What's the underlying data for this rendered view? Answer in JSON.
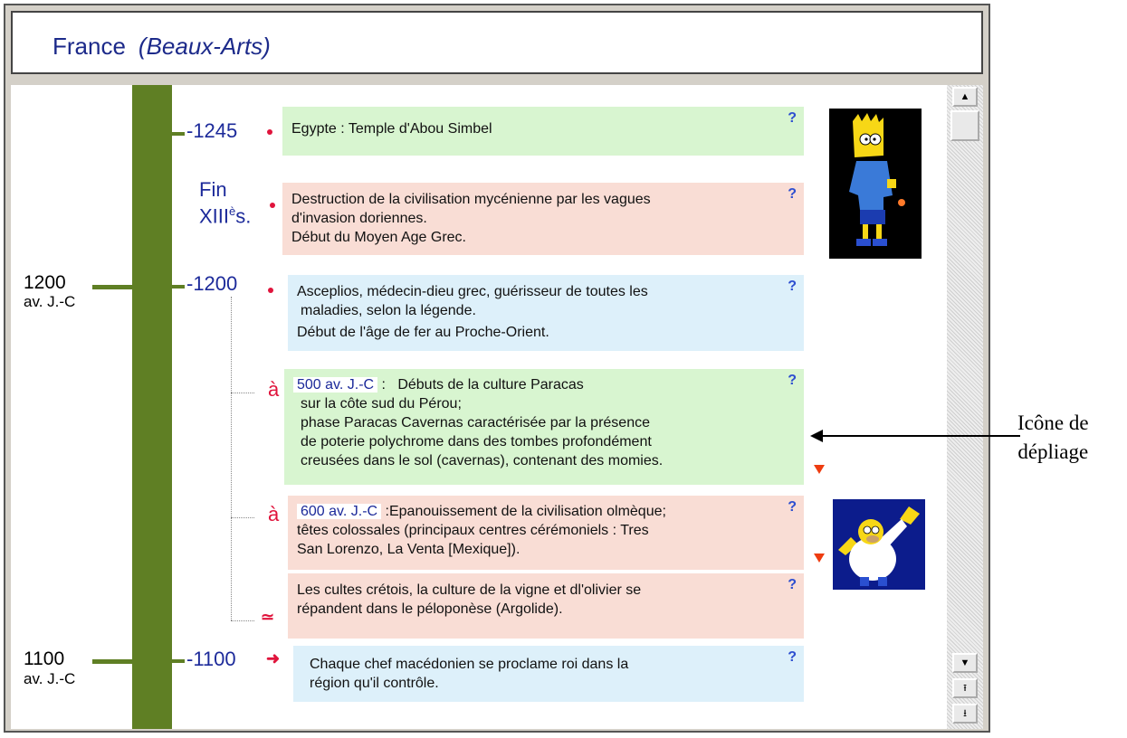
{
  "header": {
    "title": "France",
    "subtitle": "(Beaux-Arts)"
  },
  "centuries": [
    {
      "label": "1200",
      "sub": "av. J.-C"
    },
    {
      "label": "1100",
      "sub": "av. J.-C"
    }
  ],
  "years": {
    "y1245": "-1245",
    "fin_line1": "Fin",
    "fin_line2": "XIII",
    "fin_sup": "è",
    "fin_suffix": "s.",
    "y1200": "-1200",
    "y1100": "-1100"
  },
  "events": {
    "e1": {
      "text": "Egypte : Temple d'Abou Simbel"
    },
    "e2": {
      "line1": "Destruction de la civilisation mycénienne par les vagues",
      "line2": "d'invasion doriennes.",
      "line3": "Début du Moyen Age Grec."
    },
    "e3": {
      "line1": "Asceplios,  médecin-dieu grec, guérisseur de toutes les",
      "line2": "maladies, selon la légende.",
      "line3": "Début de l'âge de fer au Proche-Orient."
    },
    "e4": {
      "range_marker": "à",
      "date": "500 av. J.-C",
      "sep": ":",
      "line1": "Débuts de la culture Paracas",
      "line2": "sur la côte sud du Pérou;",
      "line3": "phase Paracas Cavernas caractérisée par la présence",
      "line4": "de poterie polychrome dans des tombes profondément",
      "line5": "creusées dans le sol (cavernas), contenant des momies."
    },
    "e5": {
      "range_marker": "à",
      "date": "600 av. J.-C",
      "line1": ":Epanouissement de la civilisation olmèque;",
      "line2": "têtes colossales (principaux centres cérémoniels : Tres",
      "line3": "San Lorenzo, La Venta [Mexique])."
    },
    "e6": {
      "line1": "Les cultes crétois, la culture de la vigne et dl'olivier se",
      "line2": "répandent dans le péloponèse (Argolide)."
    },
    "e7": {
      "line1": "Chaque chef macédonien se proclame roi dans la",
      "line2": "région qu'il contrôle."
    }
  },
  "help_label": "?",
  "approx_marker": "≃",
  "arrow_marker": "➜",
  "scroll": {
    "up": "▲",
    "down": "▼",
    "page_up": "⭱",
    "page_down": "⭳"
  },
  "annotation": {
    "line1": "Icône de",
    "line2": "dépliage"
  },
  "colors": {
    "trunk": "#5f7f24",
    "year_blue": "#1c2a9a",
    "marker_red": "#e0143c",
    "box_green": "#d8f5d0",
    "box_pink": "#f9ddd5",
    "box_blue": "#ddf0fa"
  }
}
